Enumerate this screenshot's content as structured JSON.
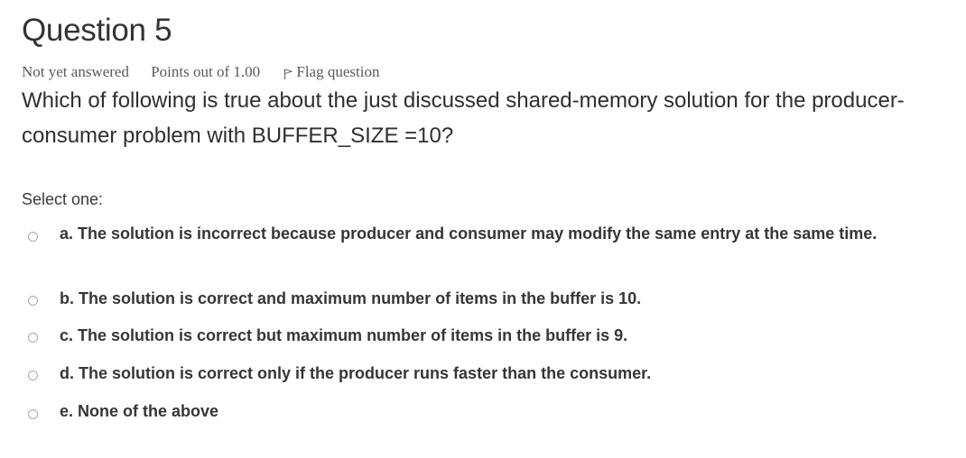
{
  "question": {
    "title": "Question 5",
    "status": "Not yet answered",
    "points": "Points out of 1.00",
    "flag_label": "Flag question",
    "text": "Which of following is true about the just discussed shared-memory solution for the producer-consumer problem with BUFFER_SIZE =10?"
  },
  "answer": {
    "prompt": "Select one:",
    "options": [
      {
        "label": "a. The solution is incorrect because producer and consumer may modify the same entry at the same time."
      },
      {
        "label": "b. The solution is correct and maximum number of items in the buffer is 10."
      },
      {
        "label": "c. The solution is correct but maximum number of items in the buffer is 9."
      },
      {
        "label": "d. The solution is correct only if the producer runs faster than the consumer."
      },
      {
        "label": "e. None of the above"
      }
    ]
  }
}
